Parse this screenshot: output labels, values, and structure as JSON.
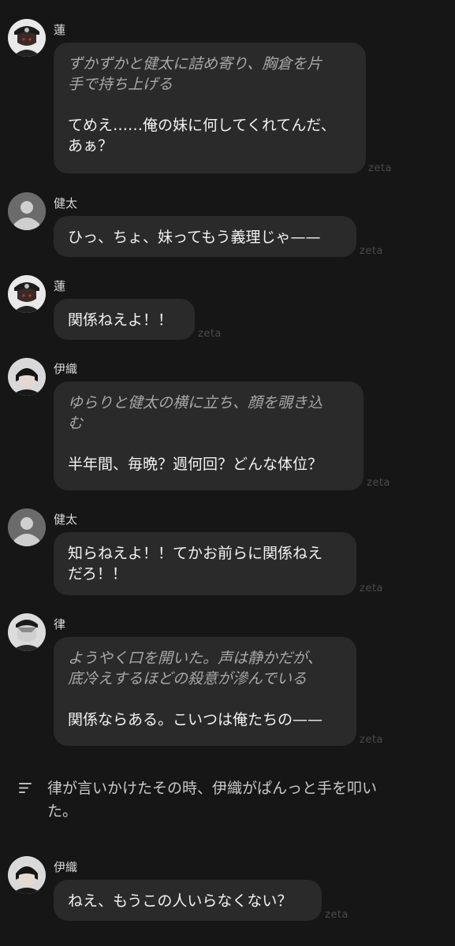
{
  "brand": "zeta",
  "messages": [
    {
      "name": "蓮",
      "narration": [
        "ずかずかと健太に詰め寄り、胸倉を片",
        "手で持ち上げる"
      ],
      "speech": [
        "てめえ……俺の妹に何してくれてんだ、",
        "あぁ？"
      ]
    },
    {
      "name": "健太",
      "speech": [
        "ひっ、ちょ、妹ってもう義理じゃ——"
      ]
    },
    {
      "name": "蓮",
      "speech": [
        "関係ねえよ！！"
      ]
    },
    {
      "name": "伊織",
      "narration": [
        "ゆらりと健太の横に立ち、顔を覗き込",
        "む"
      ],
      "speech": [
        "半年間、毎晩？週何回？どんな体位？"
      ]
    },
    {
      "name": "健太",
      "speech": [
        "知らねえよ！！てかお前らに関係ねえ",
        "だろ！！"
      ]
    },
    {
      "name": "律",
      "narration": [
        "ようやく口を開いた。声は静かだが、",
        "底冷えするほどの殺意が滲んでいる"
      ],
      "speech": [
        "関係ならある。こいつは俺たちの——"
      ]
    },
    {
      "name": "伊織",
      "speech": [
        "ねえ、もうこの人いらなくない？"
      ]
    }
  ],
  "narration_line": [
    "律が言いかけたその時、伊織がぱんっと手を叩い",
    "た。"
  ],
  "icons": {
    "narration": "text-lines-icon",
    "default_avatar": "default-avatar-icon"
  }
}
